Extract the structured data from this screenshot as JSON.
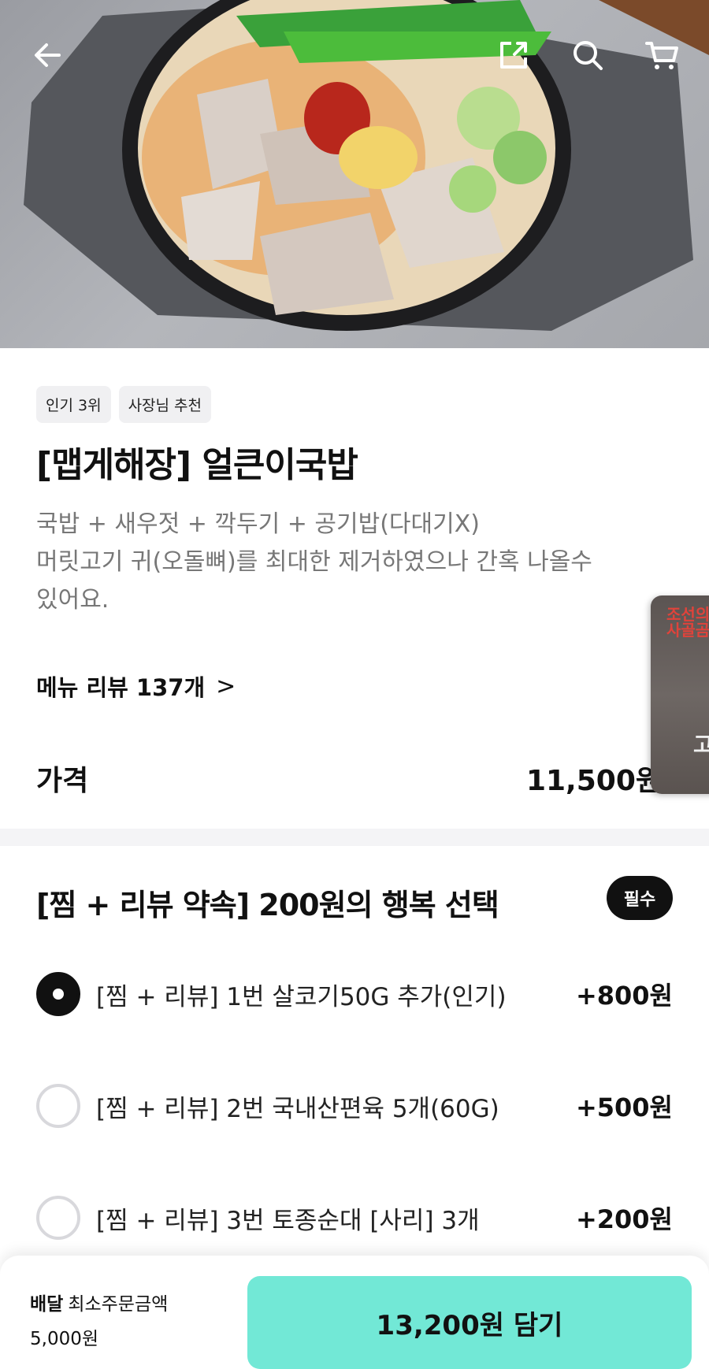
{
  "hero": {
    "image_alt": "국밥"
  },
  "top_bar": {
    "back_icon": "arrow-left-icon",
    "share_icon": "share-icon",
    "search_icon": "search-icon",
    "cart_icon": "cart-icon"
  },
  "menu": {
    "badges": [
      "인기 3위",
      "사장님 추천"
    ],
    "title": "[맵게해장] 얼큰이국밥",
    "description_line1": "국밥 + 새우젓 + 깍두기 + 공기밥(다대기X)",
    "description_line2": "머릿고기 귀(오돌뼈)를 최대한 제거하였으나 간혹 나올수",
    "description_line3": "있어요.",
    "review_link": "메뉴 리뷰 137개",
    "price_label": "가격",
    "price_value": "11,500원"
  },
  "side_thumb": {
    "text_top": "조선의\n사골곰",
    "text_bottom": "고"
  },
  "option_group": {
    "title": "[찜 + 리뷰 약속] 200원의 행복 선택",
    "required_badge": "필수",
    "options": [
      {
        "label": "[찜 + 리뷰] 1번 살코기50G 추가(인기)",
        "price": "+800원",
        "selected": true
      },
      {
        "label": "[찜 + 리뷰] 2번 국내산편육 5개(60G)",
        "price": "+500원",
        "selected": false
      },
      {
        "label": "[찜 + 리뷰] 3번 토종순대 [사리] 3개",
        "price": "+200원",
        "selected": false
      }
    ]
  },
  "bottom_bar": {
    "delivery_label": "배달",
    "min_order_label": "최소주문금액",
    "min_order_value": "5,000원",
    "cta_label": "13,200원 담기"
  },
  "colors": {
    "cta": "#72e8d6",
    "selected_radio": "#111111",
    "muted_text": "#777777"
  }
}
